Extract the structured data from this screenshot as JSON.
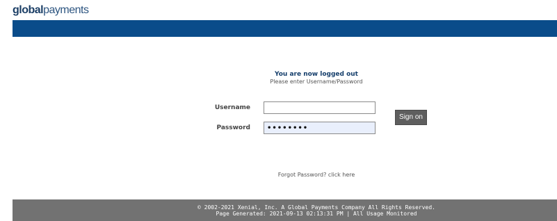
{
  "header": {
    "logo_bold": "global",
    "logo_light": "payments",
    "brand_color": "#0a4c8a"
  },
  "status": {
    "title": "You are now logged out",
    "subtitle": "Please enter Username/Password"
  },
  "form": {
    "username_label": "Username",
    "password_label": "Password",
    "username_value": "",
    "password_display": "••••••••",
    "sign_on_label": "Sign on"
  },
  "forgot": {
    "text": "Forgot Password? click here"
  },
  "footer": {
    "copyright": "© 2002-2021 Xenial, Inc. A Global Payments Company All Rights Reserved.",
    "generated": "Page Generated: 2021-09-13 02:13:31 PM |  All Usage Monitored",
    "background": "#727272"
  }
}
